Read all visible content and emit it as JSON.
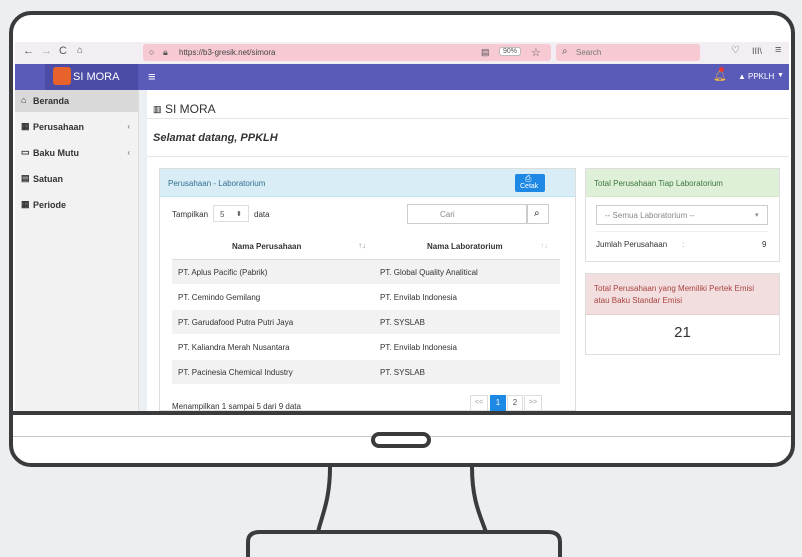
{
  "browser": {
    "nav_icons": [
      "back-icon",
      "forward-icon",
      "reload-icon",
      "home-icon"
    ],
    "url": "https://b3-gresik.net/simora",
    "zoom": "90%",
    "search_placeholder": "Search"
  },
  "app": {
    "brand": "SI MORA",
    "menu_icon": "≡",
    "user": "PPKLH",
    "page_title": "SI MORA",
    "welcome": "Selamat datang, PPKLH"
  },
  "sidebar": {
    "items": [
      {
        "label": "Beranda",
        "icon": "home-icon",
        "active": true,
        "chevron": false
      },
      {
        "label": "Perusahaan",
        "icon": "building-icon",
        "active": false,
        "chevron": true
      },
      {
        "label": "Baku Mutu",
        "icon": "calendar-icon",
        "active": false,
        "chevron": true
      },
      {
        "label": "Satuan",
        "icon": "table-icon",
        "active": false,
        "chevron": false
      },
      {
        "label": "Periode",
        "icon": "calendar-grid-icon",
        "active": false,
        "chevron": false
      }
    ]
  },
  "lab_panel": {
    "title": "Perusahaan - Laboratorium",
    "print_label": "Cetak",
    "show_label": "Tampilkan",
    "show_value": "5",
    "data_label": "data",
    "search_placeholder": "Cari",
    "columns": [
      "Nama Perusahaan",
      "Nama Laboratorium"
    ],
    "rows": [
      {
        "company": "PT. Aplus Pacific (Pabrik)",
        "lab": "PT. Global Quality Analitical"
      },
      {
        "company": "PT. Cemindo Gemilang",
        "lab": "PT. Envilab Indonesia"
      },
      {
        "company": "PT. Garudafood Putra Putri Jaya",
        "lab": "PT. SYSLAB"
      },
      {
        "company": "PT. Kaliandra Merah Nusantara",
        "lab": "PT. Envilab Indonesia"
      },
      {
        "company": "PT. Pacinesia Chemical Industry",
        "lab": "PT. SYSLAB"
      }
    ],
    "footer": "Menampilkan 1 sampai 5 dari 9 data",
    "pagination": {
      "prev": "<<",
      "pages": [
        "1",
        "2"
      ],
      "next": ">>",
      "current": "1"
    }
  },
  "total_panel": {
    "title": "Total Perusahaan Tiap Laboratorium",
    "select_value": "-- Semua Laboratorium --",
    "count_label": "Jumlah Perusahaan",
    "colon": ":",
    "count_value": "9"
  },
  "emission_panel": {
    "title": "Total Perusahaan yang Memiliki Pertek Emisi atau Baku Standar Emisi",
    "value": "21"
  },
  "colors": {
    "navbar": "#5a5bb8",
    "panel_info_header": "#d9edf7",
    "panel_success_header": "#dff0d8",
    "panel_danger_header": "#f2dede",
    "primary": "#1e88e5"
  }
}
